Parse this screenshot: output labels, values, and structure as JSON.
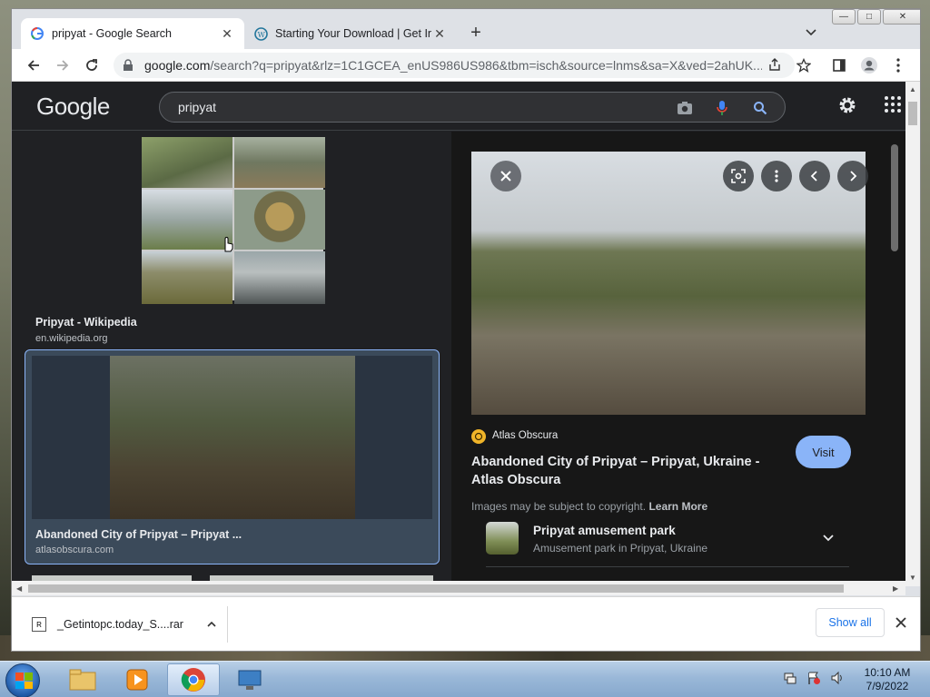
{
  "browser": {
    "tabs": [
      {
        "title": "pripyat - Google Search",
        "active": true
      },
      {
        "title": "Starting Your Download | Get Into",
        "active": false
      }
    ],
    "url_host": "google.com",
    "url_path": "/search?q=pripyat&rlz=1C1GCEA_enUS986US986&tbm=isch&source=lnms&sa=X&ved=2ahUK...",
    "window_controls": {
      "minimize": "—",
      "maximize": "□",
      "close": "✕"
    }
  },
  "google": {
    "logo": "Google",
    "query": "pripyat"
  },
  "results": {
    "wiki": {
      "title": "Pripyat - Wikipedia",
      "source": "en.wikipedia.org"
    },
    "selected": {
      "title": "Abandoned City of Pripyat – Pripyat ...",
      "source": "atlasobscura.com"
    }
  },
  "viewer": {
    "source_name": "Atlas Obscura",
    "title": "Abandoned City of Pripyat – Pripyat, Ukraine - Atlas Obscura",
    "visit_label": "Visit",
    "copyright_text": "Images may be subject to copyright.",
    "learn_more": "Learn More",
    "related": {
      "title": "Pripyat amusement park",
      "subtitle": "Amusement park in Pripyat, Ukraine"
    }
  },
  "downloads": {
    "file_name": "_Getintopc.today_S....rar",
    "show_all": "Show all"
  },
  "taskbar": {
    "time": "10:10 AM",
    "date": "7/9/2022"
  },
  "colors": {
    "google_dark_bg": "#202124",
    "accent_blue": "#8ab4f8",
    "link_blue": "#1a73e8"
  }
}
